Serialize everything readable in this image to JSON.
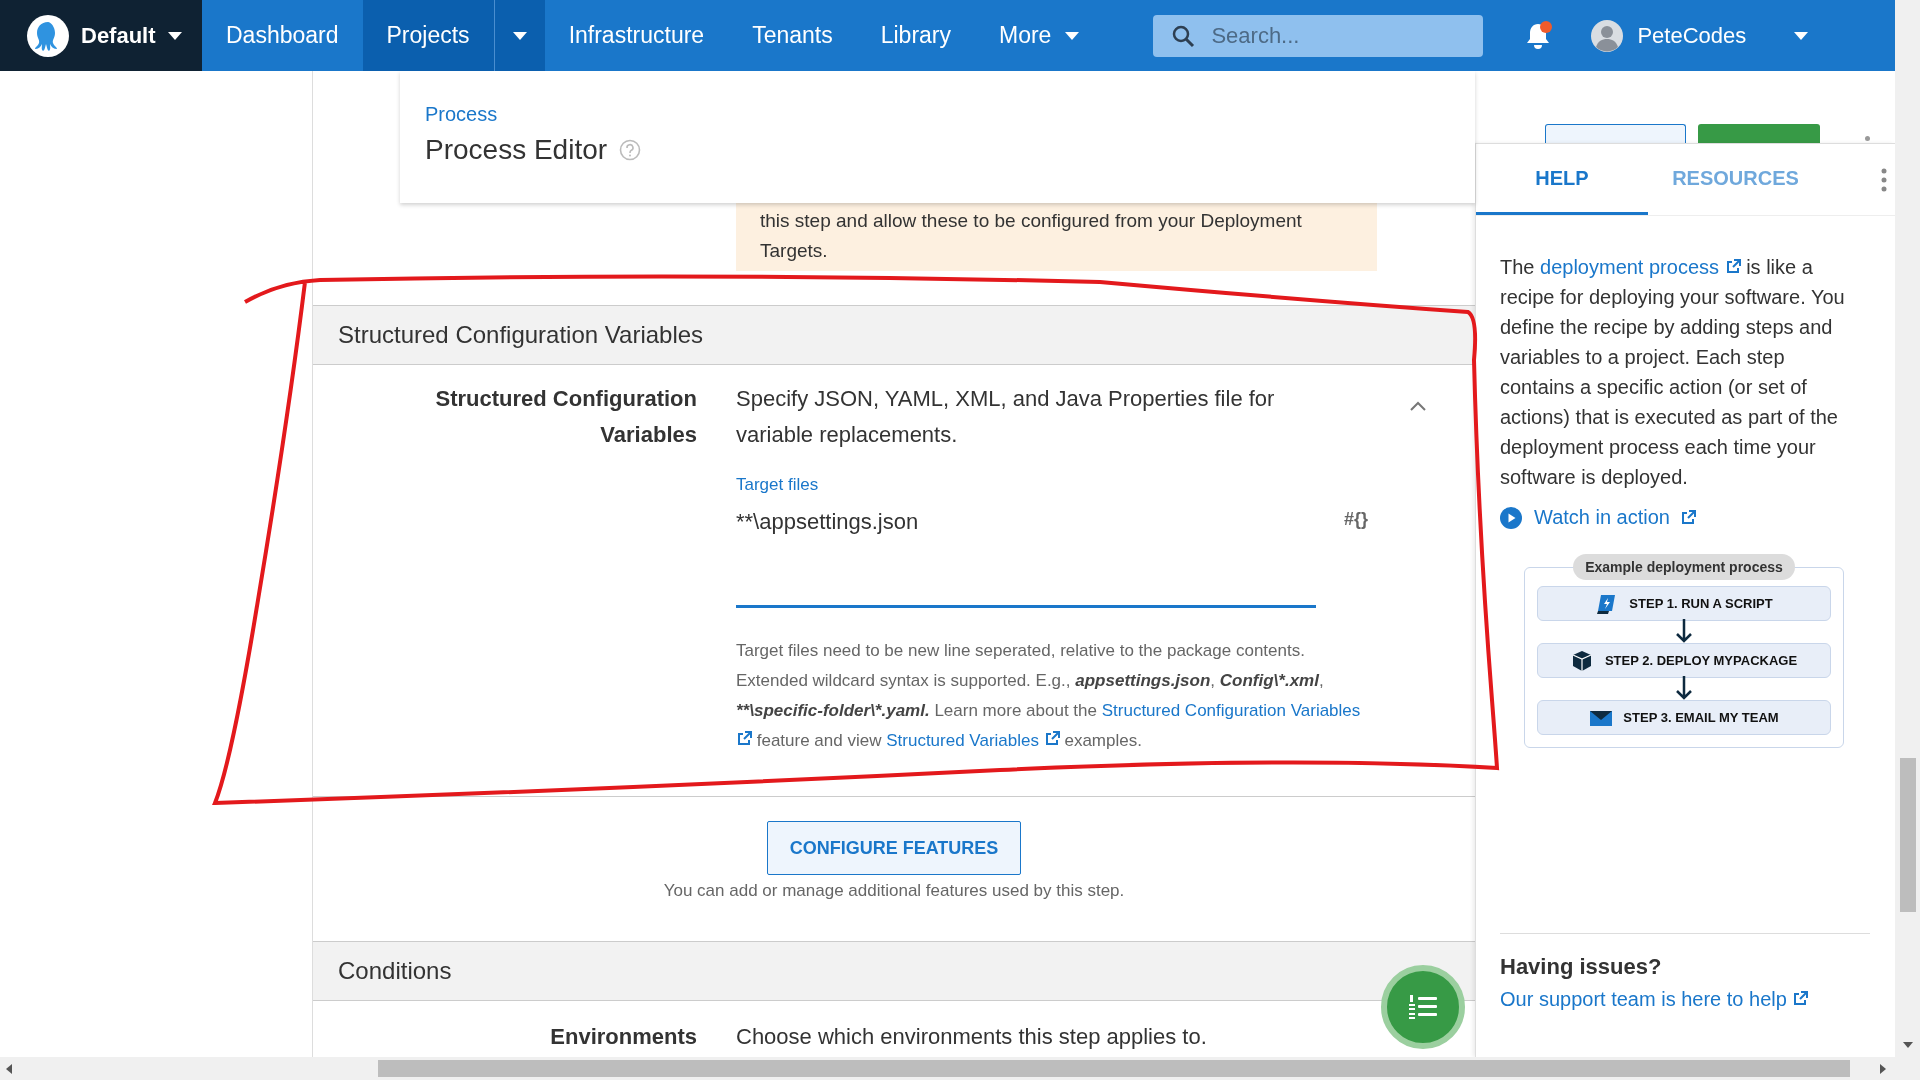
{
  "nav": {
    "space": "Default",
    "items": [
      {
        "label": "Dashboard",
        "selected": false,
        "kind": "link"
      },
      {
        "label": "Projects",
        "selected": true,
        "kind": "split"
      },
      {
        "label": "Infrastructure",
        "selected": false,
        "kind": "link"
      },
      {
        "label": "Tenants",
        "selected": false,
        "kind": "link"
      },
      {
        "label": "Library",
        "selected": false,
        "kind": "link"
      },
      {
        "label": "More",
        "selected": false,
        "kind": "menu"
      }
    ],
    "search": {
      "placeholder": "Search..."
    },
    "notifications": {
      "unread": true
    },
    "user": {
      "name": "PeteCodes"
    }
  },
  "header": {
    "breadcrumb": "Process",
    "title": "Process Editor"
  },
  "notice": {
    "text": "this step and allow these to be configured from your Deployment Targets."
  },
  "sections": [
    {
      "title": "Structured Configuration Variables",
      "label": "Structured Configuration Variables",
      "description": "Specify JSON, YAML, XML, and Java Properties file for variable replacements.",
      "expanded": true,
      "field": {
        "label": "Target files",
        "value": "**\\appsettings.json",
        "focused": true,
        "insert_button": "#{}"
      },
      "help": [
        {
          "kind": "text",
          "text": "Target files need to be new line seperated, relative to the package contents. Extended wildcard syntax is supported. E.g., "
        },
        {
          "kind": "code",
          "text": "appsettings.json"
        },
        {
          "kind": "text",
          "text": ", "
        },
        {
          "kind": "code",
          "text": "Config\\*.xml"
        },
        {
          "kind": "text",
          "text": ", "
        },
        {
          "kind": "code",
          "text": "**\\specific-folder\\*.yaml."
        },
        {
          "kind": "text",
          "text": " Learn more about the "
        },
        {
          "kind": "link",
          "text": "Structured Configuration Variables"
        },
        {
          "kind": "text",
          "text": " feature and view "
        },
        {
          "kind": "link",
          "text": "Structured Variables"
        },
        {
          "kind": "text",
          "text": " examples."
        }
      ]
    }
  ],
  "features": {
    "button": "CONFIGURE FEATURES",
    "caption": "You can add or manage additional features used by this step."
  },
  "conditions": {
    "title": "Conditions",
    "label": "Environments",
    "description": "Choose which environments this step applies to."
  },
  "side_panel": {
    "tabs": [
      {
        "label": "HELP",
        "selected": true
      },
      {
        "label": "RESOURCES",
        "selected": false
      }
    ],
    "intro": [
      {
        "kind": "text",
        "text": "The "
      },
      {
        "kind": "link",
        "text": "deployment process"
      },
      {
        "kind": "text",
        "text": " is like a recipe for deploying your software. You define the recipe by adding steps and variables to a project. Each step contains a specific action (or set of actions) that is executed as part of the deployment process each time your software is deployed."
      }
    ],
    "watch": "Watch in action",
    "diagram": {
      "title": "Example deployment process",
      "steps": [
        {
          "label": "STEP 1. RUN A SCRIPT",
          "kind": "script"
        },
        {
          "label": "STEP 2. DEPLOY MYPACKAGE",
          "kind": "package"
        },
        {
          "label": "STEP 3. EMAIL MY TEAM",
          "kind": "email"
        }
      ]
    },
    "issues": {
      "title": "Having issues?",
      "link": "Our support team is here to help"
    }
  }
}
